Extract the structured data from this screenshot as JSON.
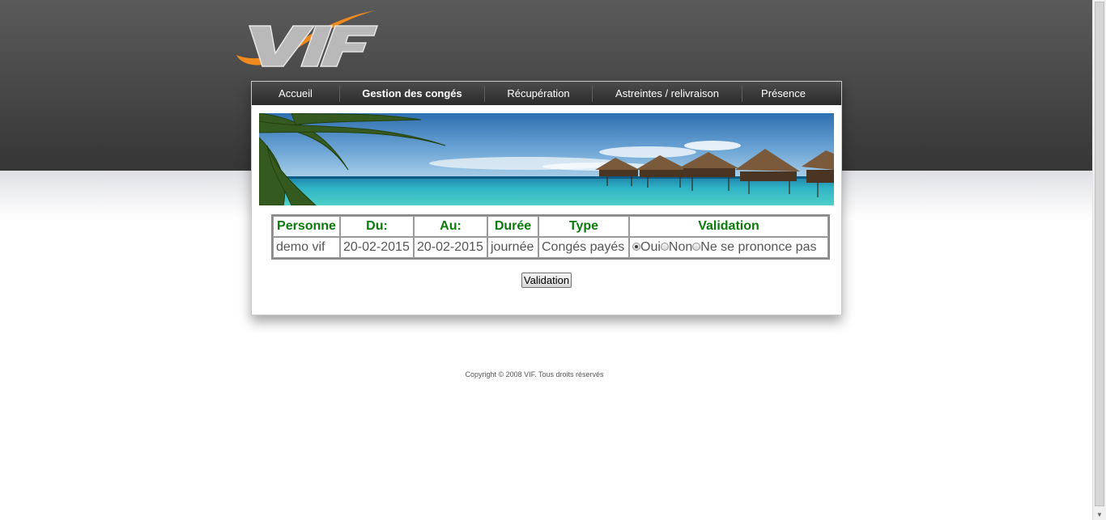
{
  "logo": {
    "text": "VIF",
    "accent_color": "#f08a1c",
    "letter_color": "#b9b9b9"
  },
  "nav": {
    "items": [
      {
        "label": "Accueil",
        "active": false
      },
      {
        "label": "Gestion des congés",
        "active": true
      },
      {
        "label": "Récupération",
        "active": false
      },
      {
        "label": "Astreintes / relivraison",
        "active": false
      },
      {
        "label": "Présence",
        "active": false
      }
    ]
  },
  "table": {
    "headers": [
      "Personne",
      "Du:",
      "Au:",
      "Durée",
      "Type",
      "Validation"
    ],
    "rows": [
      {
        "personne": "demo vif",
        "du": "20-02-2015",
        "au": "20-02-2015",
        "duree": "journée",
        "type": "Congés payés",
        "validation": {
          "selected": "Oui",
          "options": [
            "Oui",
            "Non",
            "Ne se prononce pas"
          ]
        }
      }
    ],
    "header_color": "#0a7a0a"
  },
  "validate_button": {
    "label": "Validation"
  },
  "footer": {
    "text": "Copyright © 2008 VIF. Tous droits réservés"
  }
}
